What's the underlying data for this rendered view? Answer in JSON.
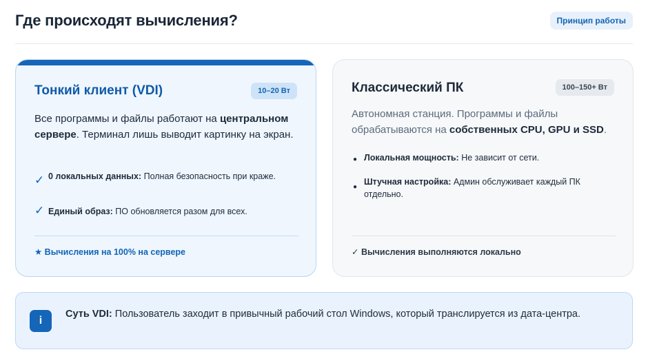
{
  "header": {
    "title": "Где происходят вычисления?",
    "principle_button": "Принцип работы"
  },
  "vdi_card": {
    "title": "Тонкий клиент (VDI)",
    "badge": "10–20 Вт",
    "desc_part1": "Все программы и файлы работают на ",
    "desc_bold": "центральном сервере",
    "desc_part2": ". Терминал лишь выводит картинку на экран.",
    "features": [
      {
        "mark": "✓",
        "bold": "0 локальных данных:",
        "text": " Полная безопасность при краже."
      },
      {
        "mark": "✓",
        "bold": "Единый образ:",
        "text": " ПО обновляется разом для всех."
      }
    ],
    "footer": "★ Вычисления на 100% на сервере"
  },
  "pc_card": {
    "title": "Классический ПК",
    "badge": "100–150+ Вт",
    "desc_part1": "Автономная станция. Программы и файлы обрабатываются на ",
    "desc_bold": "собственных CPU, GPU и SSD",
    "desc_part2": ".",
    "features": [
      {
        "mark": "●",
        "bold": "Локальная мощность:",
        "text": " Не зависит от сети."
      },
      {
        "mark": "●",
        "bold": "Штучная настройка:",
        "text": " Админ обслуживает каждый ПК отдельно."
      }
    ],
    "footer": "✓ Вычисления выполняются локально"
  },
  "info": {
    "icon": "i",
    "icon_name": "info-icon",
    "bold": "Суть VDI:",
    "text": " Пользователь заходит в привычный рабочий стол Windows, который транслируется из дата-центра."
  },
  "colors": {
    "accent": "#1565b8",
    "vdi_bg": "#eff6fe",
    "pc_bg": "#f6f8fa"
  }
}
